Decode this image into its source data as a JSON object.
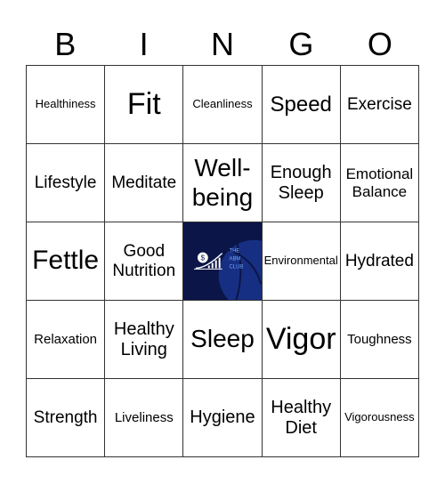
{
  "header": [
    "B",
    "I",
    "N",
    "G",
    "O"
  ],
  "cells": [
    "Healthiness",
    "Fit",
    "Cleanliness",
    "Speed",
    "Exercise",
    "Lifestyle",
    "Meditate",
    "Well-being",
    "Enough Sleep",
    "Emotional Balance",
    "Fettle",
    "Good Nutrition",
    "",
    "Environmental",
    "Hydrated",
    "Relaxation",
    "Healthy Living",
    "Sleep",
    "Vigor",
    "Toughness",
    "Strength",
    "Liveliness",
    "Hygiene",
    "Healthy Diet",
    "Vigorousness"
  ],
  "free_space": {
    "logo_text": [
      "THE",
      "ABM",
      "CLUB"
    ],
    "icon": "head-dollar-growth-chart-icon"
  }
}
